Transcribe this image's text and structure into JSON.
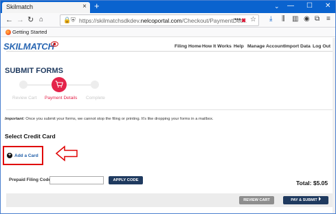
{
  "browser": {
    "tab_title": "Skilmatch",
    "tab_close": "×",
    "new_tab": "+",
    "url_host": "skilmatchsdkdev.",
    "url_domain": "nelcoportal.com",
    "url_path": "/Checkout/PaymentDet...",
    "url_prefix": "https://",
    "bookmark": "Getting Started"
  },
  "header": {
    "logo_text": "SKILMATCH",
    "menu": [
      "Filing Home",
      "How It Works",
      "Help",
      "Manage Account",
      "Import Data",
      "Log Out"
    ]
  },
  "page": {
    "title": "SUBMIT FORMS",
    "steps": [
      "Review Cart",
      "Payment Details",
      "Complete"
    ],
    "active_step": 1,
    "important_label": "Important:",
    "important_text": " Once you submit your forms, we cannot stop the filing or printing. It's like dropping your forms in a mailbox.",
    "select_title": "Select Credit Card",
    "add_card_label": "Add a Card",
    "prepaid_label": "Prepaid Filing Code:",
    "prepaid_value": "",
    "apply_label": "APPLY CODE",
    "total": "Total: $5.05",
    "review_cart_label": "REVIEW CART",
    "pay_submit_label": "PAY & SUBMIT"
  },
  "colors": {
    "accent": "#e4234a",
    "navy": "#1f3a5f",
    "titlebar": "#0a63cf",
    "highlight": "#e00000"
  }
}
